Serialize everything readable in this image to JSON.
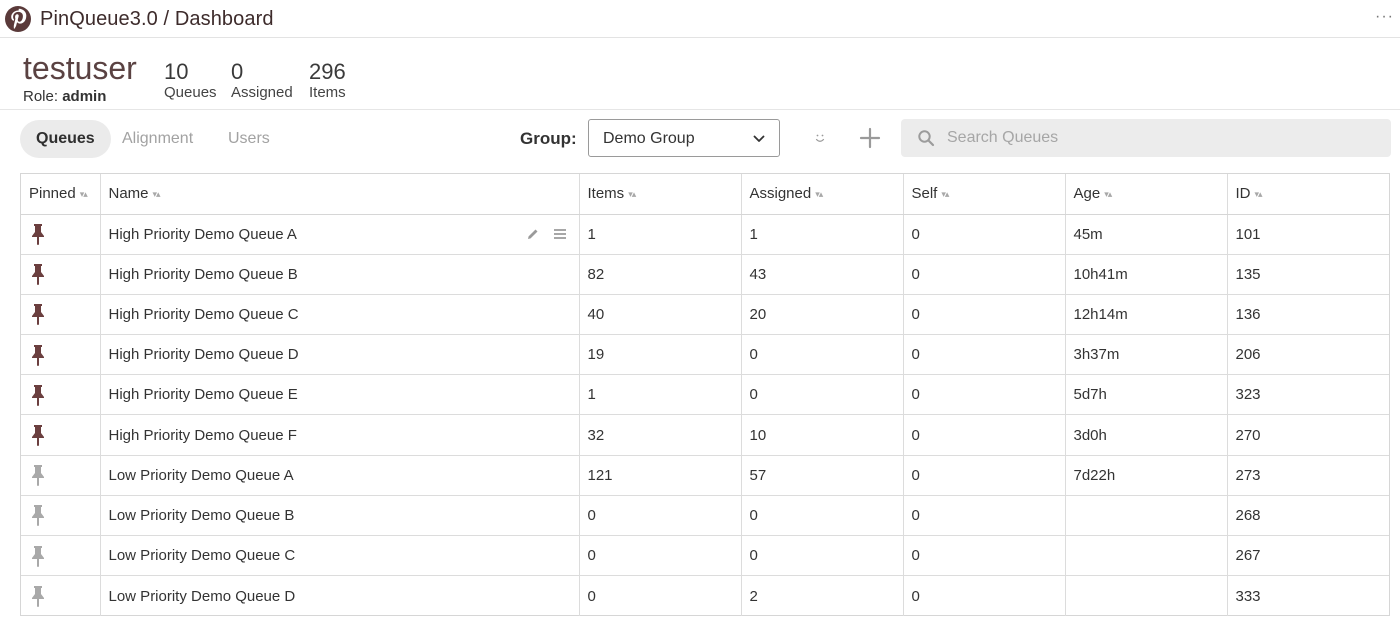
{
  "header": {
    "title": "PinQueue3.0 / Dashboard",
    "more_label": "···"
  },
  "user": {
    "name": "testuser",
    "role_label": "Role:",
    "role": "admin",
    "stats": [
      {
        "value": "10",
        "label": "Queues"
      },
      {
        "value": "0",
        "label": "Assigned"
      },
      {
        "value": "296",
        "label": "Items"
      }
    ]
  },
  "tabs": [
    {
      "label": "Queues",
      "active": true
    },
    {
      "label": "Alignment",
      "active": false
    },
    {
      "label": "Users",
      "active": false
    }
  ],
  "group": {
    "label": "Group:",
    "selected": "Demo Group"
  },
  "search": {
    "placeholder": "Search Queues",
    "value": ""
  },
  "colors": {
    "pinned": "#6b3f3f",
    "unpinned": "#a9a9a9",
    "accent": "#5a4242"
  },
  "table": {
    "columns": [
      "Pinned",
      "Name",
      "Items",
      "Assigned",
      "Self",
      "Age",
      "ID"
    ],
    "rows": [
      {
        "pinned": true,
        "name": "High Priority Demo Queue A",
        "items": "1",
        "assigned": "1",
        "self": "0",
        "age": "45m",
        "id": "101"
      },
      {
        "pinned": true,
        "name": "High Priority Demo Queue B",
        "items": "82",
        "assigned": "43",
        "self": "0",
        "age": "10h41m",
        "id": "135"
      },
      {
        "pinned": true,
        "name": "High Priority Demo Queue C",
        "items": "40",
        "assigned": "20",
        "self": "0",
        "age": "12h14m",
        "id": "136"
      },
      {
        "pinned": true,
        "name": "High Priority Demo Queue D",
        "items": "19",
        "assigned": "0",
        "self": "0",
        "age": "3h37m",
        "id": "206"
      },
      {
        "pinned": true,
        "name": "High Priority Demo Queue E",
        "items": "1",
        "assigned": "0",
        "self": "0",
        "age": "5d7h",
        "id": "323"
      },
      {
        "pinned": true,
        "name": "High Priority Demo Queue F",
        "items": "32",
        "assigned": "10",
        "self": "0",
        "age": "3d0h",
        "id": "270"
      },
      {
        "pinned": false,
        "name": "Low Priority Demo Queue A",
        "items": "121",
        "assigned": "57",
        "self": "0",
        "age": "7d22h",
        "id": "273"
      },
      {
        "pinned": false,
        "name": "Low Priority Demo Queue B",
        "items": "0",
        "assigned": "0",
        "self": "0",
        "age": "",
        "id": "268"
      },
      {
        "pinned": false,
        "name": "Low Priority Demo Queue C",
        "items": "0",
        "assigned": "0",
        "self": "0",
        "age": "",
        "id": "267"
      },
      {
        "pinned": false,
        "name": "Low Priority Demo Queue D",
        "items": "0",
        "assigned": "2",
        "self": "0",
        "age": "",
        "id": "333"
      }
    ]
  }
}
